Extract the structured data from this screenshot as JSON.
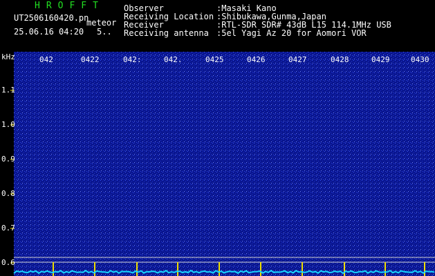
{
  "header": {
    "brand": "HROFFT",
    "filename": "UT2506160420.pn",
    "mode": "meteor",
    "datetime": "25.06.16 04:20",
    "extra": "5..",
    "info_labels": [
      "Observer",
      "Receiving Location",
      "Receiver",
      "Receiving antenna"
    ],
    "info_values": [
      ":Masaki Kano",
      ":Shibukawa,Gunma,Japan",
      ":RTL-SDR SDR# 43dB L15 114.1MHz USB",
      ":5el Yagi Az 20 for Aomori VOR"
    ]
  },
  "axis": {
    "unit": "kHz",
    "y_ticks": [
      "1.1",
      "1.0",
      "0.9",
      "0.8",
      "0.7",
      "0.6"
    ],
    "time_ticks": [
      "042",
      "0422",
      "042:",
      "042.",
      "0425",
      "0426",
      "0427",
      "0428",
      "0429",
      "0430"
    ]
  },
  "colors": {
    "background": "#000000",
    "spectrum": "#0a1690",
    "brand": "#22e022",
    "trace": "#17d7ff"
  }
}
